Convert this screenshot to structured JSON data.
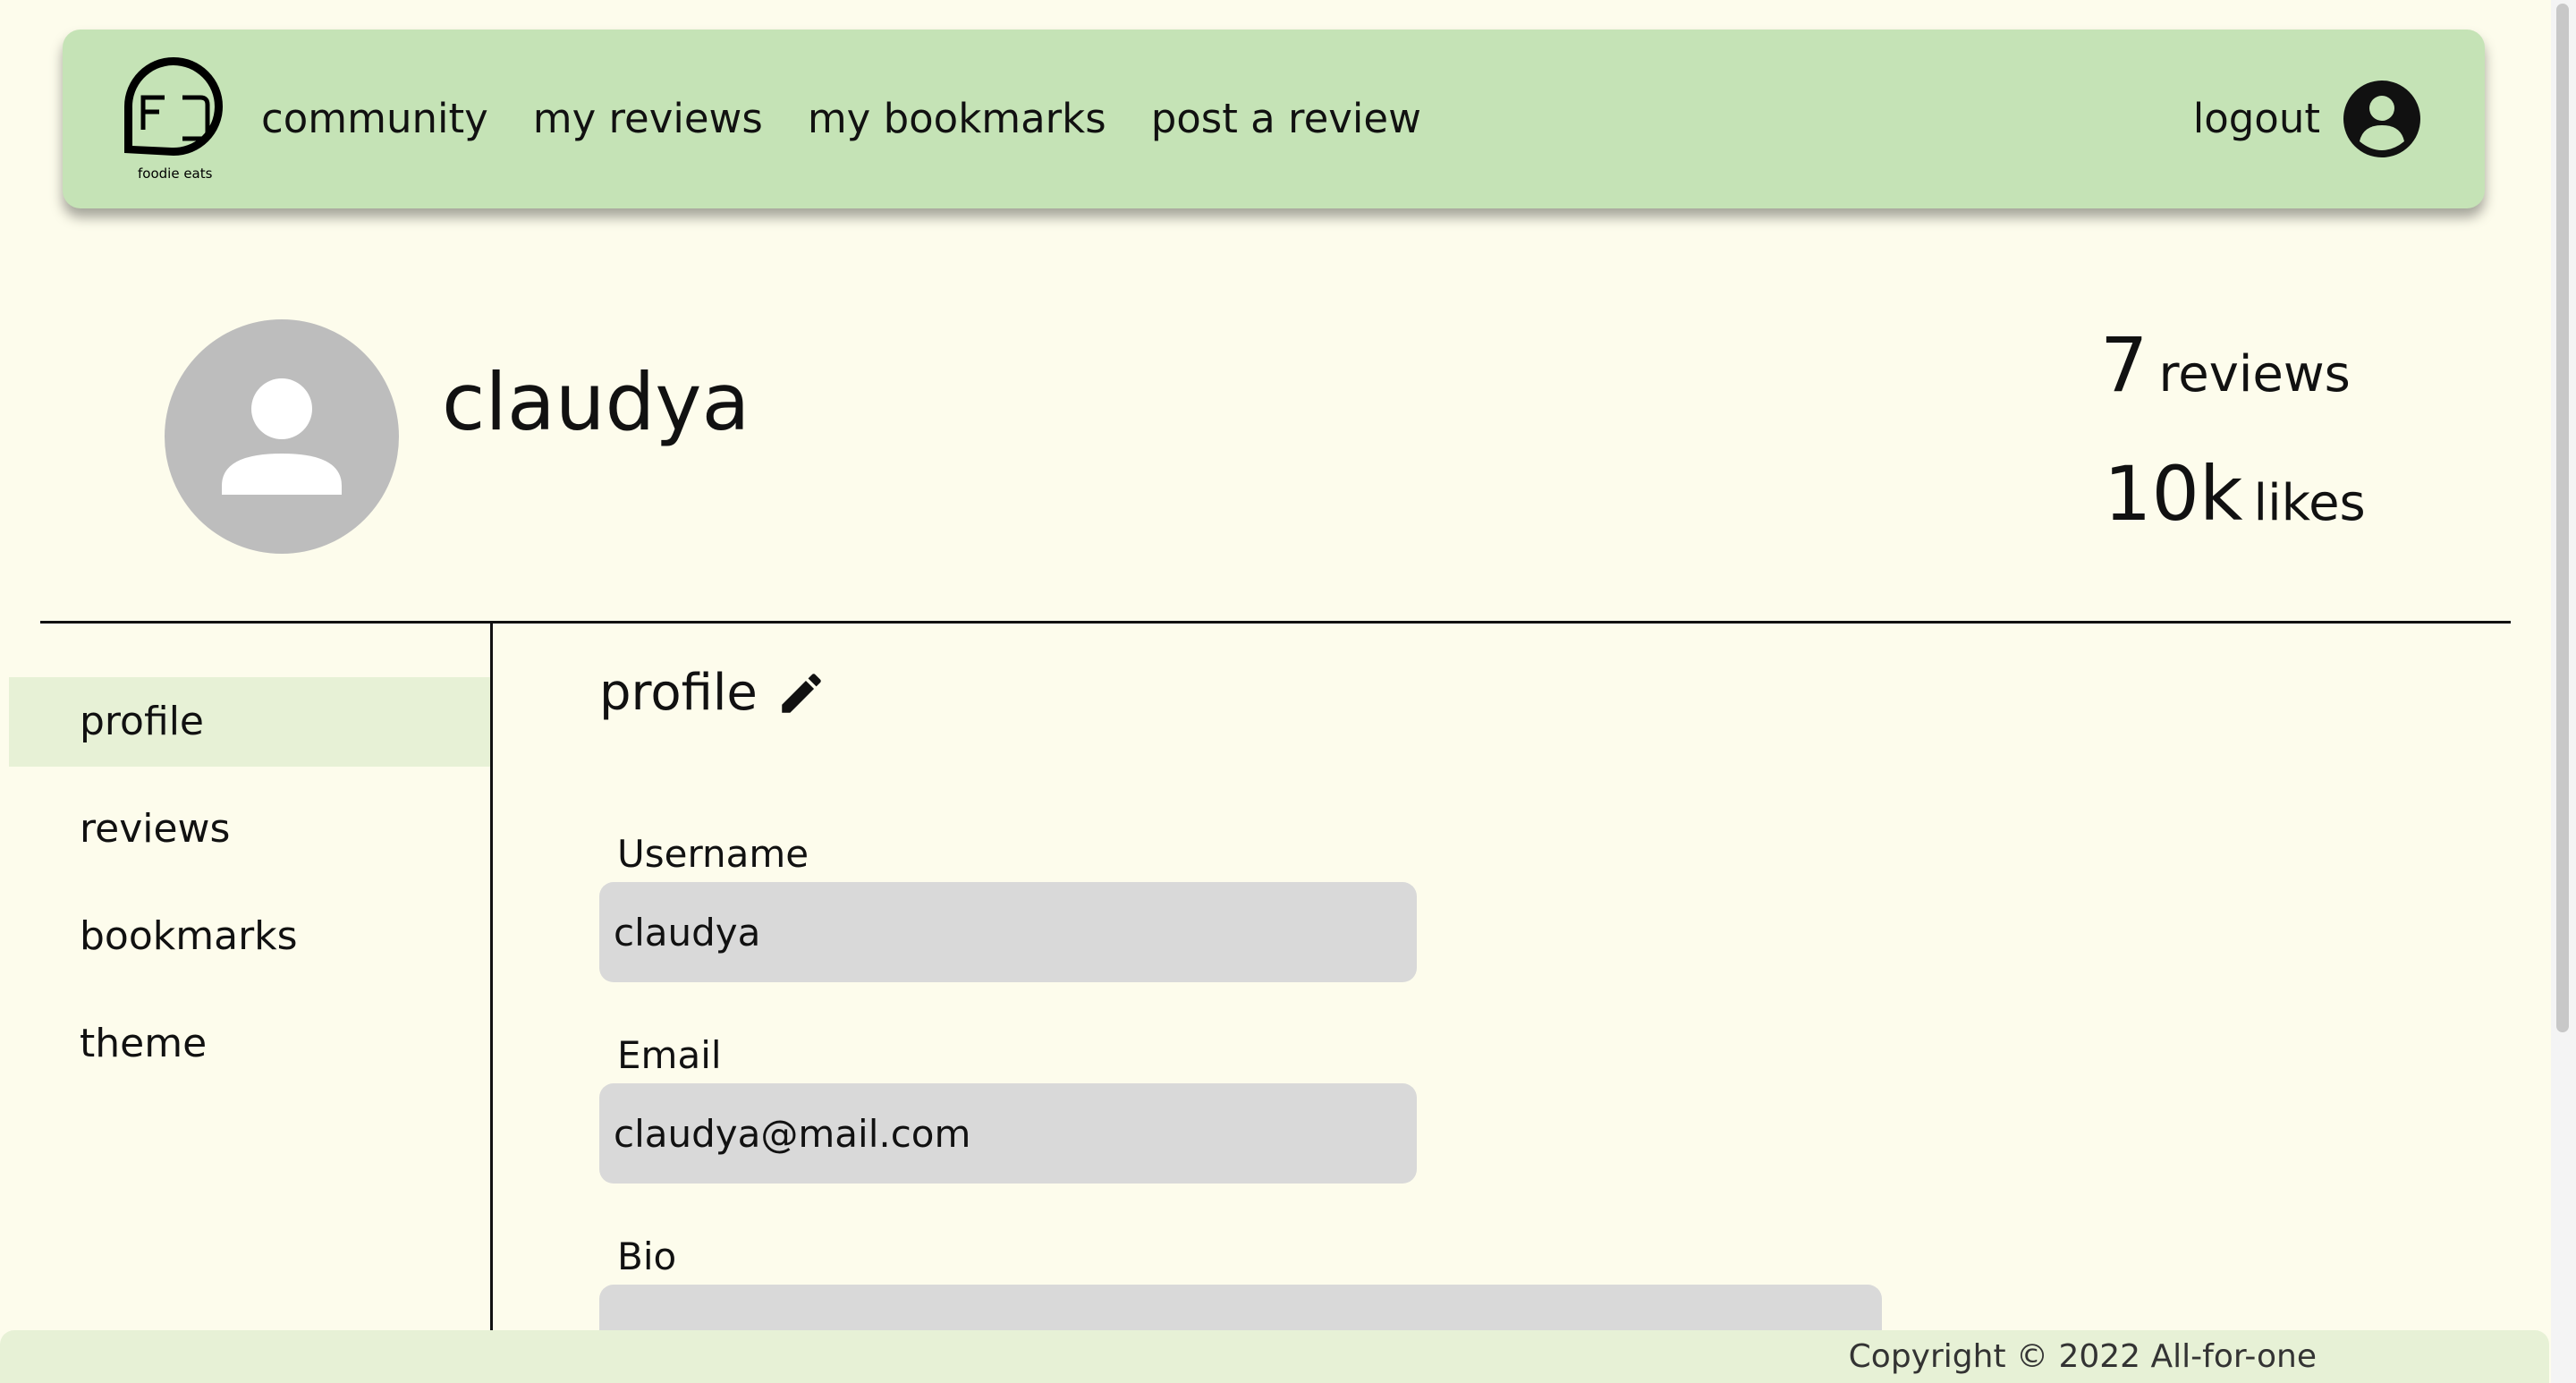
{
  "nav": {
    "logo_text": "foodie eats",
    "links": [
      "community",
      "my reviews",
      "my bookmarks",
      "post a review"
    ],
    "logout": "logout"
  },
  "profile": {
    "username": "claudya",
    "reviews_count": "7",
    "reviews_label": "reviews",
    "likes_count": "10k",
    "likes_label": "likes"
  },
  "sidebar": {
    "items": [
      "profile",
      "reviews",
      "bookmarks",
      "theme"
    ],
    "active": "profile"
  },
  "main": {
    "section_title": "profile",
    "fields": {
      "username_label": "Username",
      "username_value": "claudya",
      "email_label": "Email",
      "email_value": "claudya@mail.com",
      "bio_label": "Bio",
      "bio_value": ""
    }
  },
  "footer": {
    "copyright": "Copyright © 2022 All-for-one"
  },
  "colors": {
    "background": "#fdfcec",
    "navbar": "#c5e3b6",
    "sidebar_active": "#e7f1d6",
    "input_bg": "#d9d9d9",
    "avatar_gray": "#bdbdbd"
  }
}
